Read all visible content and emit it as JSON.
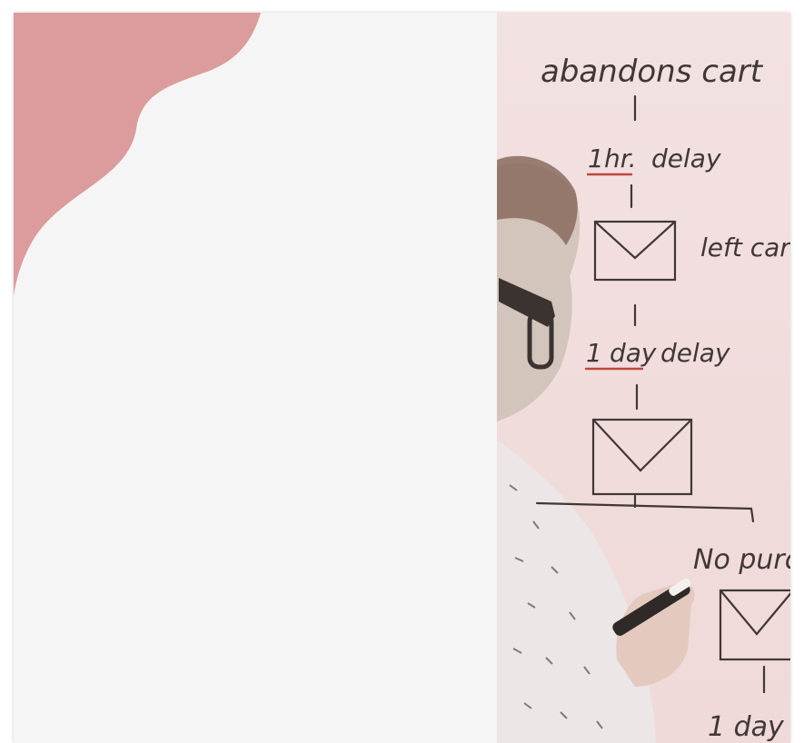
{
  "colors": {
    "blob": "#dc9b9c",
    "card_bg": "#f5f5f5",
    "photo_tint": "#f1dcdc",
    "marker_ink": "#3f3836",
    "underline_red": "#c0463d"
  },
  "whiteboard": {
    "title": "abandons cart",
    "step1_qty": "1",
    "step1_unit": "hr.",
    "step1_word": "delay",
    "email1_note": "left cart",
    "step2_qty": "1",
    "step2_unit": "day",
    "step2_word": "delay",
    "branch_note": "No purch",
    "step3_text": "1 day"
  },
  "icons": {
    "email1": "envelope-icon",
    "email2": "envelope-icon",
    "email3": "envelope-icon",
    "marker": "marker-icon"
  }
}
